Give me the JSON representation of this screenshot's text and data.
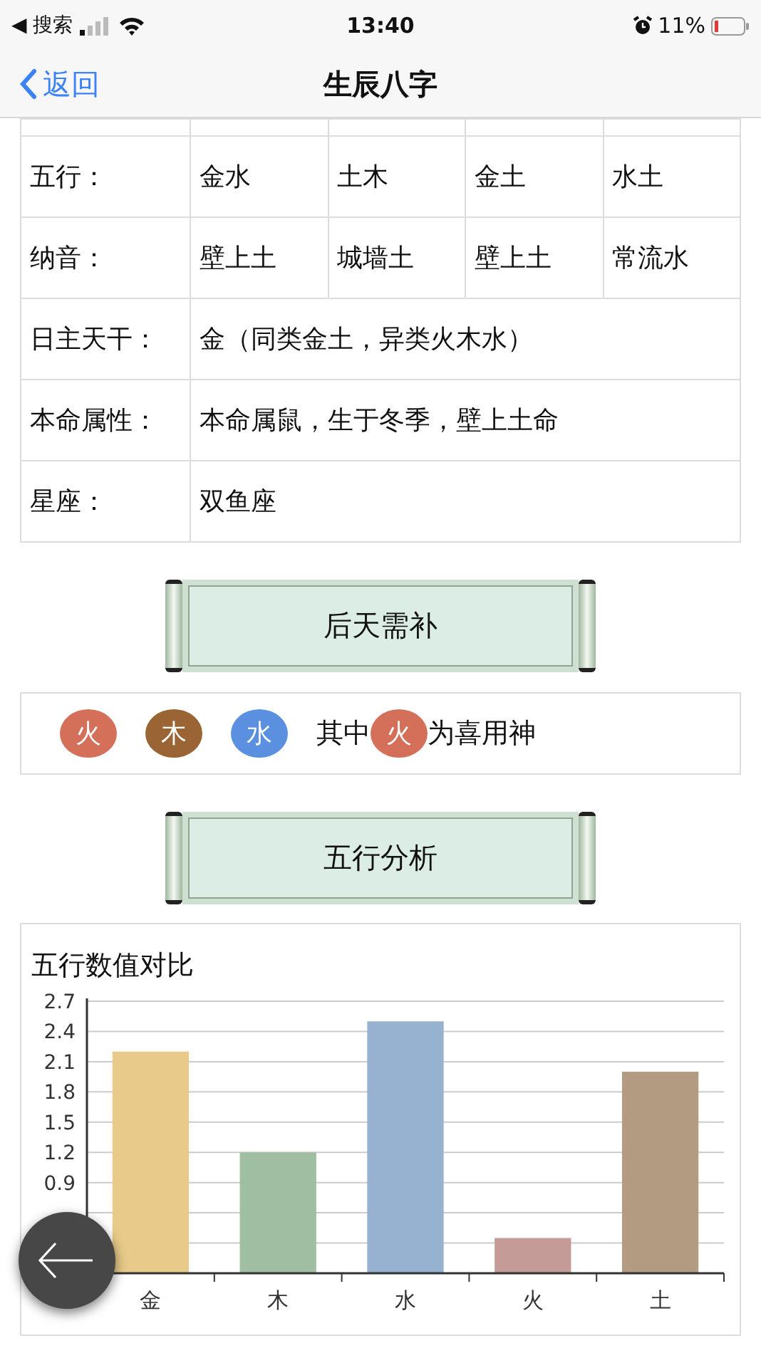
{
  "status_bar": {
    "back_app": "◀ 搜索",
    "time": "13:40",
    "battery": "11%"
  },
  "nav_bar": {
    "back": "返回",
    "title": "生辰八字"
  },
  "table": {
    "rows": [
      {
        "label": "五行：",
        "cells": [
          "金水",
          "土木",
          "金土",
          "水土"
        ]
      },
      {
        "label": "纳音：",
        "cells": [
          "壁上土",
          "城墙土",
          "壁上土",
          "常流水"
        ]
      },
      {
        "label": "日主天干：",
        "cells": [
          {
            "text": "金（同类金土，异类火木水）",
            "colspan": 4
          }
        ]
      },
      {
        "label": "本命属性：",
        "cells": [
          {
            "text": "本命属鼠，生于冬季，壁上土命",
            "colspan": 4
          }
        ]
      },
      {
        "label": "星座：",
        "cells": [
          {
            "text": "双鱼座",
            "colspan": 4
          }
        ]
      }
    ]
  },
  "needs_banner": "后天需补",
  "needs": {
    "elements": [
      {
        "label": "火",
        "color": "#d4705a"
      },
      {
        "label": "木",
        "color": "#9a6434"
      },
      {
        "label": "水",
        "color": "#5b8fe0"
      }
    ],
    "prefix": "其中",
    "favorable": {
      "label": "火",
      "color": "#d4705a"
    },
    "suffix": "为喜用神"
  },
  "analysis_banner": "五行分析",
  "chart_data": {
    "type": "bar",
    "title": "五行数值对比",
    "categories": [
      "金",
      "木",
      "水",
      "火",
      "土"
    ],
    "values": [
      2.2,
      1.2,
      2.5,
      0.35,
      2.0
    ],
    "colors": [
      "#e8cb8a",
      "#a0bfa2",
      "#97b1d1",
      "#c59b98",
      "#b39b81"
    ],
    "ylim": [
      0,
      2.7
    ],
    "grid": true,
    "yticks": [
      0.9,
      1.2,
      1.5,
      1.8,
      2.1,
      2.4,
      2.7
    ]
  }
}
